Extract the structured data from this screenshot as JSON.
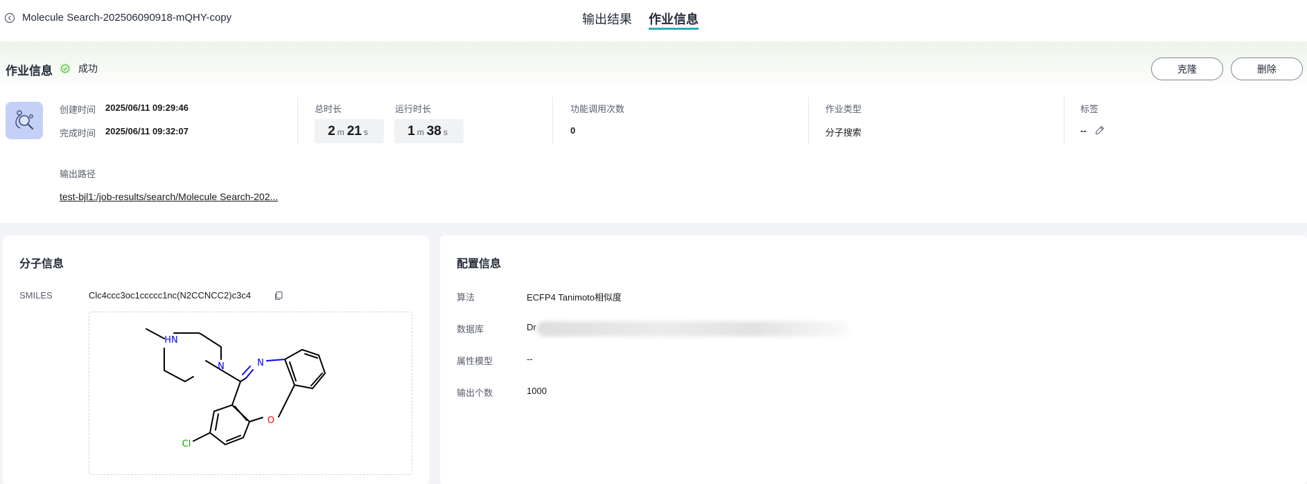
{
  "header": {
    "job_name": "Molecule Search-202506090918-mQHY-copy",
    "tabs": [
      {
        "label": "输出结果",
        "active": false
      },
      {
        "label": "作业信息",
        "active": true
      }
    ]
  },
  "job_info": {
    "title": "作业信息",
    "status": "成功",
    "status_color": "#5ec04a",
    "accent_color": "#2aaab9",
    "buttons": {
      "clone": "克隆",
      "delete": "删除"
    },
    "created_label": "创建时间",
    "created_value": "2025/06/11 09:29:46",
    "finished_label": "完成时间",
    "finished_value": "2025/06/11 09:32:07",
    "total_label": "总时长",
    "total": {
      "min": "2",
      "min_unit": "m",
      "sec": "21",
      "sec_unit": "s"
    },
    "run_label": "运行时长",
    "run": {
      "min": "1",
      "min_unit": "m",
      "sec": "38",
      "sec_unit": "s"
    },
    "calls_label": "功能调用次数",
    "calls_value": "0",
    "type_label": "作业类型",
    "type_value": "分子搜索",
    "tag_label": "标签",
    "tag_value": "--",
    "path_label": "输出路径",
    "path_value": "test-bjl1:/job-results/search/Molecule Search-202..."
  },
  "molecule": {
    "title": "分子信息",
    "smiles_label": "SMILES",
    "smiles_value": "Clc4ccc3oc1ccccc1nc(N2CCNCC2)c3c4",
    "atoms": {
      "hn": "HN",
      "n1": "N",
      "n2": "N",
      "o": "O",
      "cl": "Cl"
    },
    "atom_colors": {
      "nitrogen": "#0000ff",
      "oxygen": "#ff0000",
      "chlorine": "#00aa00"
    }
  },
  "config": {
    "title": "配置信息",
    "rows": [
      {
        "label": "算法",
        "value": "ECFP4 Tanimoto相似度"
      },
      {
        "label": "数据库",
        "value": "Dr"
      },
      {
        "label": "属性模型",
        "value": "--"
      },
      {
        "label": "输出个数",
        "value": "1000"
      }
    ]
  }
}
